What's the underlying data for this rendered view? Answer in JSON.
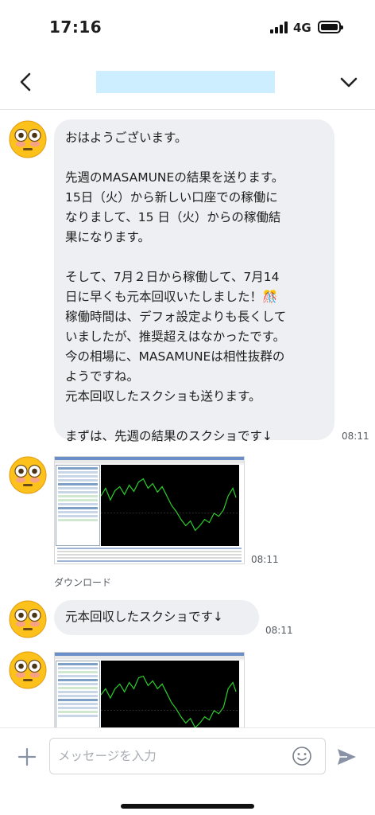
{
  "status_bar": {
    "time": "17:16",
    "network": "4G"
  },
  "header": {
    "title": "",
    "title_color": "#cdeefe"
  },
  "messages": [
    {
      "type": "text",
      "avatar_icon": "flushed-face-icon",
      "lines": [
        "おはようございます。",
        "",
        "先週のMASAMUNEの結果を送ります。",
        "15日（火）から新しい口座での稼働に",
        "なりまして、15 日（火）からの稼働結",
        "果になります。",
        "",
        "そして、7月２日から稼働して、7月14",
        "日に早くも元本回収いたしました！🎊",
        "稼働時間は、デフォ設定よりも長くして",
        "いましたが、推奨超えはなかったです。",
        "今の相場に、MASAMUNEは相性抜群の",
        "ようですね。",
        "元本回収したスクショも送ります。",
        "",
        "まずは、先週の結果のスクショです↓"
      ],
      "time": "08:11"
    },
    {
      "type": "image",
      "avatar_icon": "flushed-face-icon",
      "time": "08:11",
      "download_label": "ダウンロード"
    },
    {
      "type": "text",
      "avatar_icon": "flushed-face-icon",
      "lines": [
        "元本回収したスクショです↓"
      ],
      "time": "08:11"
    },
    {
      "type": "image",
      "avatar_icon": "flushed-face-icon"
    }
  ],
  "input": {
    "placeholder": "メッセージを入力",
    "value": ""
  },
  "colors": {
    "bubble": "#eeeff3",
    "chart_line": "#2bd12b",
    "chart_bg": "#000000",
    "send": "#8a93a6"
  }
}
